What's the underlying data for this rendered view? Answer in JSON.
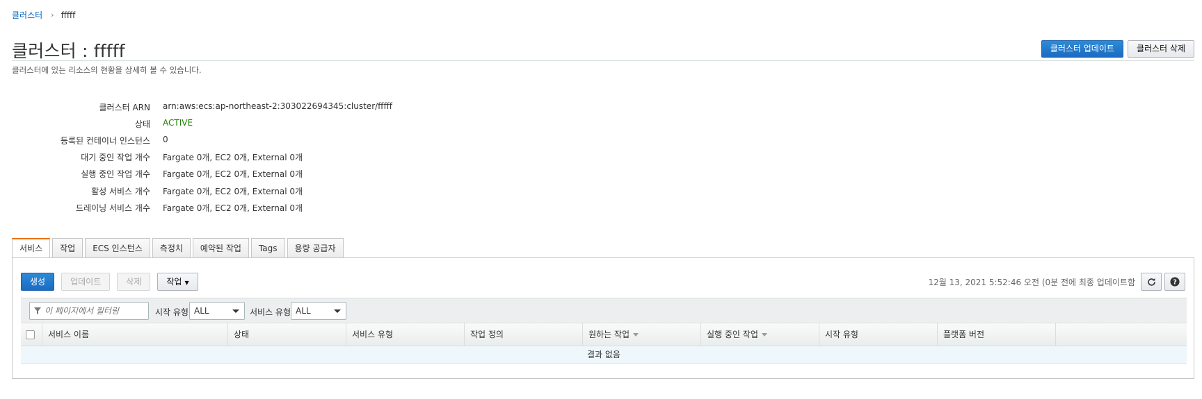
{
  "breadcrumb": {
    "parent": "클러스터",
    "separator": "›",
    "current": "fffff"
  },
  "header": {
    "title": "클러스터 : fffff",
    "subtitle": "클러스터에 있는 리소스의 현황을 상세히 볼 수 있습니다.",
    "update_button": "클러스터 업데이트",
    "delete_button": "클러스터 삭제"
  },
  "details": [
    {
      "label": "클러스터 ARN",
      "value": "arn:aws:ecs:ap-northeast-2:303022694345:cluster/fffff"
    },
    {
      "label": "상태",
      "value": "ACTIVE"
    },
    {
      "label": "등록된 컨테이너 인스턴스",
      "value": "0"
    },
    {
      "label": "대기 중인 작업 개수",
      "value": "Fargate 0개, EC2 0개, External 0개"
    },
    {
      "label": "실행 중인 작업 개수",
      "value": "Fargate 0개, EC2 0개, External 0개"
    },
    {
      "label": "활성 서비스 개수",
      "value": "Fargate 0개, EC2 0개, External 0개"
    },
    {
      "label": "드레이닝 서비스 개수",
      "value": "Fargate 0개, EC2 0개, External 0개"
    }
  ],
  "tabs": [
    "서비스",
    "작업",
    "ECS 인스턴스",
    "측정치",
    "예약된 작업",
    "Tags",
    "용량 공급자"
  ],
  "toolbar": {
    "create": "생성",
    "update": "업데이트",
    "delete": "삭제",
    "actions": "작업",
    "timestamp": "12월 13, 2021 5:52:46 오전 (0분 전에 최종 업데이트함"
  },
  "filters": {
    "placeholder": "이 페이지에서 필터링",
    "launch_type_label": "시작 유형",
    "launch_type_value": "ALL",
    "service_type_label": "서비스 유형",
    "service_type_value": "ALL"
  },
  "table": {
    "columns": [
      "서비스 이름",
      "상태",
      "서비스 유형",
      "작업 정의",
      "원하는 작업",
      "실행 중인 작업",
      "시작 유형",
      "플랫폼 버전"
    ],
    "empty_text": "결과 없음"
  },
  "colors": {
    "primary": "#1a6bc3",
    "active_status": "#1d8102",
    "tab_accent": "#ec7211",
    "link": "#0066c0"
  }
}
